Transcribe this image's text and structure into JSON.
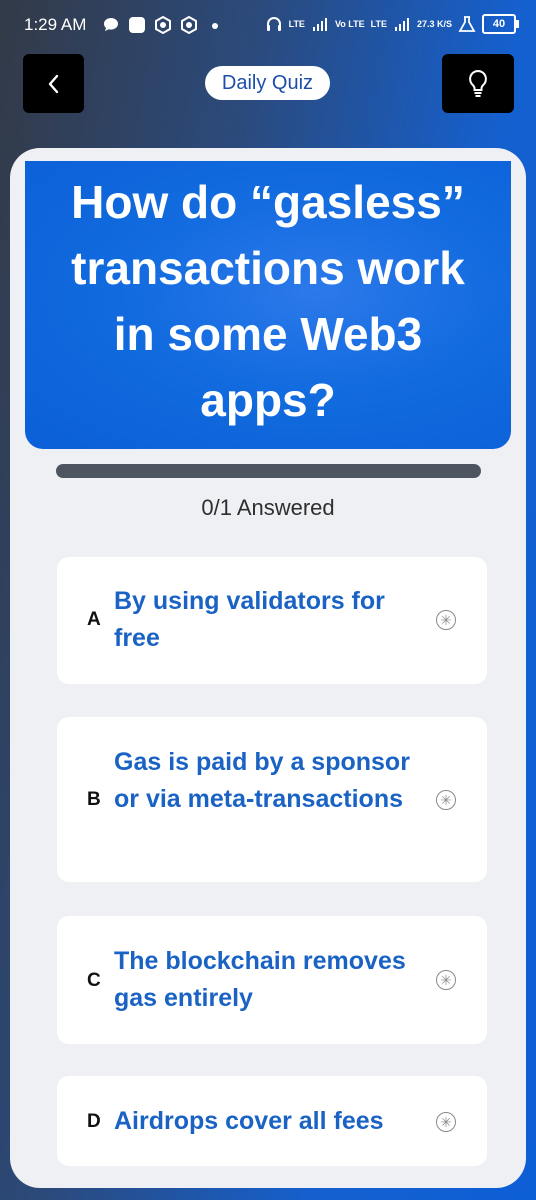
{
  "status_bar": {
    "time": "1:29 AM",
    "net1": "LTE",
    "net2": "Vo LTE",
    "net3": "LTE",
    "speed": "27.3 K/S",
    "battery": "40"
  },
  "header": {
    "title": "Daily Quiz",
    "back_icon": "chevron-left-icon",
    "hint_icon": "lightbulb-icon"
  },
  "question": {
    "text": "How do “gasless” transactions work in some Web3 apps?"
  },
  "progress": {
    "answered_label": "0/1 Answered",
    "fraction": 0
  },
  "options": [
    {
      "letter": "A",
      "text": "By using validators for free"
    },
    {
      "letter": "B",
      "text": "Gas is paid by a sponsor or via meta-transactions"
    },
    {
      "letter": "C",
      "text": "The blockchain removes gas entirely"
    },
    {
      "letter": "D",
      "text": "Airdrops cover all fees"
    }
  ],
  "colors": {
    "accent": "#0d5fd6",
    "option_text": "#1a63c4",
    "card_bg": "#eff0f3"
  }
}
